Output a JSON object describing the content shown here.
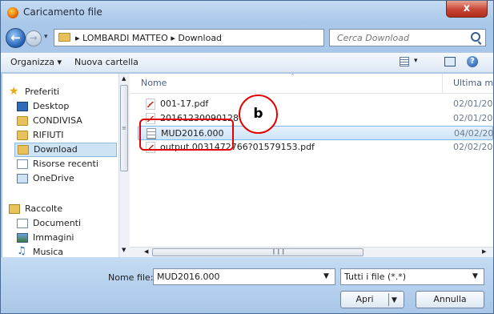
{
  "window": {
    "title": "Caricamento file",
    "close_label": "x"
  },
  "address": {
    "path_text": "▸ LOMBARDI MATTEO ▸ Download",
    "search_placeholder": "Cerca Download"
  },
  "toolbar": {
    "organize_label": "Organizza ▾",
    "new_folder_label": "Nuova cartella",
    "help_label": "?"
  },
  "sidebar": {
    "favorites_label": "Preferiti",
    "favorites": [
      {
        "label": "Desktop",
        "icon": "desktop-icon"
      },
      {
        "label": "CONDIVISA",
        "icon": "folder-icon"
      },
      {
        "label": "RIFIUTI",
        "icon": "folder-icon"
      },
      {
        "label": "Download",
        "icon": "download-folder-icon"
      },
      {
        "label": "Risorse recenti",
        "icon": "recent-places-icon"
      },
      {
        "label": "OneDrive",
        "icon": "onedrive-icon"
      }
    ],
    "libraries_label": "Raccolte",
    "libraries": [
      {
        "label": "Documenti",
        "icon": "documents-icon"
      },
      {
        "label": "Immagini",
        "icon": "pictures-icon"
      },
      {
        "label": "Musica",
        "icon": "music-icon"
      }
    ]
  },
  "file_list": {
    "columns": {
      "name": "Nome",
      "date": "Ultima m"
    },
    "files": [
      {
        "name": "001-17.pdf",
        "date": "02/01/201",
        "icon": "pdf-icon"
      },
      {
        "name": "20161230090128015.p",
        "date": "02/01/201",
        "icon": "pdf-icon"
      },
      {
        "name": "MUD2016.000",
        "date": "04/02/201",
        "icon": "file-icon",
        "selected": true
      },
      {
        "name": "output.0031472766?01579153.pdf",
        "date": "02/02/201",
        "icon": "pdf-icon"
      }
    ]
  },
  "bottom": {
    "filename_label": "Nome file:",
    "filename_value": "MUD2016.000",
    "filter_value": "Tutti i file (*.*)",
    "open_label": "Apri",
    "cancel_label": "Annulla"
  },
  "annotation": {
    "label": "b",
    "color": "#e30000"
  }
}
